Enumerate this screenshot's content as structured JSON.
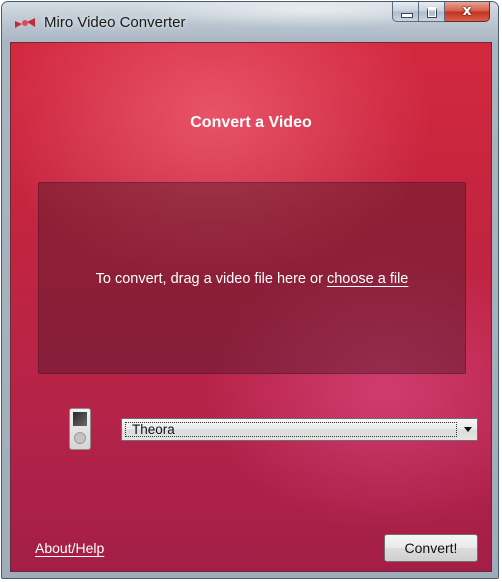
{
  "window": {
    "title": "Miro Video Converter",
    "app_icon": "miro-logo-icon",
    "controls": {
      "minimize_icon": "minimize-icon",
      "maximize_icon": "maximize-icon",
      "close_icon": "close-icon",
      "close_glyph": "x"
    }
  },
  "main": {
    "heading": "Convert a Video",
    "drop_zone": {
      "text_prefix": "To convert, drag a video file here or ",
      "link_text": "choose a file"
    },
    "device_icon": "media-player-icon",
    "format_select": {
      "selected": "Theora",
      "arrow_icon": "chevron-down-icon"
    },
    "about_link": "About/Help",
    "convert_button": "Convert!"
  },
  "colors": {
    "accent": "#c3243f",
    "text_on_accent": "#ffffff"
  }
}
